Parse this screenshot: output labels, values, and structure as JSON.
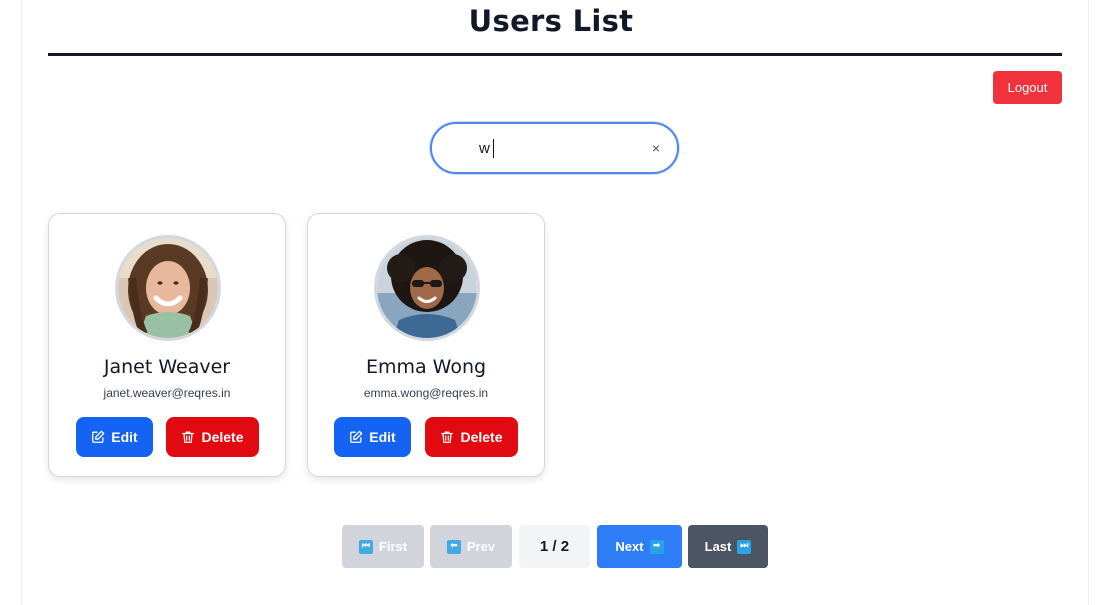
{
  "header": {
    "title": "Users List",
    "logout_label": "Logout"
  },
  "search": {
    "value": "w",
    "placeholder": "",
    "clear_symbol": "×"
  },
  "users": [
    {
      "name": "Janet Weaver",
      "email": "janet.weaver@reqres.in",
      "edit_label": "Edit",
      "delete_label": "Delete"
    },
    {
      "name": "Emma Wong",
      "email": "emma.wong@reqres.in",
      "edit_label": "Edit",
      "delete_label": "Delete"
    }
  ],
  "pagination": {
    "first_label": "First",
    "prev_label": "Prev",
    "page_info": "1 / 2",
    "next_label": "Next",
    "last_label": "Last",
    "current_page": 1,
    "total_pages": 2
  },
  "colors": {
    "logout": "#f0323c",
    "edit": "#1463f3",
    "delete": "#e10a10",
    "next": "#2f7df6",
    "last": "#4b5563",
    "disabled": "#d1d5db",
    "search_border": "#4f86e8"
  },
  "icons": {
    "clear": "close-icon",
    "edit": "edit-icon",
    "delete": "trash-icon",
    "first": "first-page-icon",
    "prev": "prev-arrow-icon",
    "next": "next-arrow-icon",
    "last": "last-page-icon"
  }
}
